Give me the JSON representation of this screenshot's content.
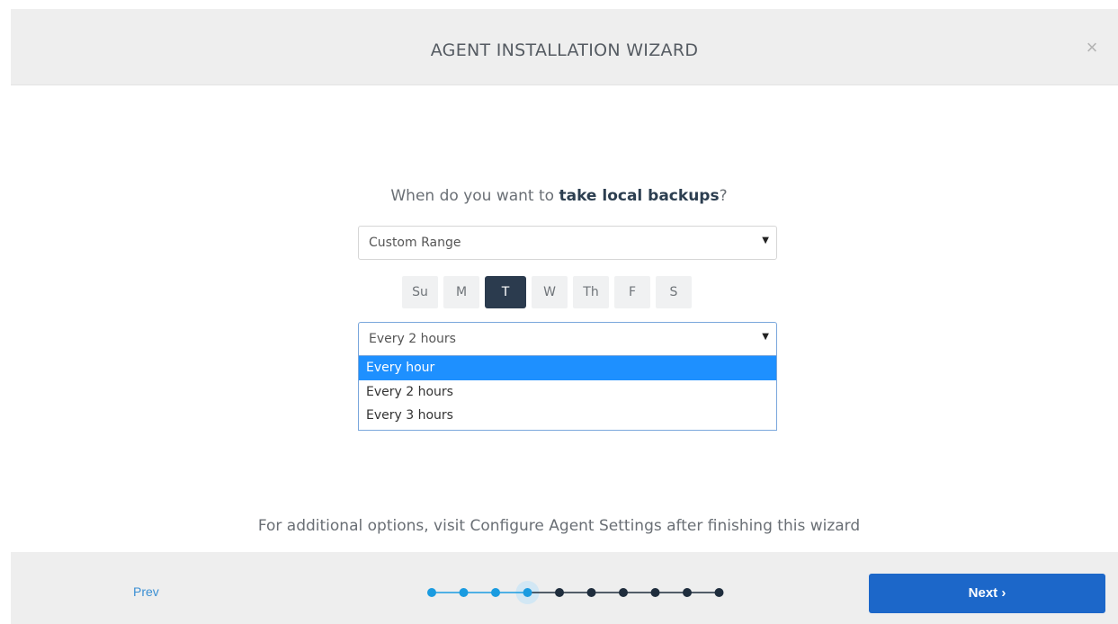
{
  "header": {
    "title": "AGENT INSTALLATION WIZARD",
    "close_label": "×"
  },
  "question": {
    "prefix": "When do you want to ",
    "emphasis": "take local backups",
    "suffix": "?"
  },
  "range_select": {
    "value": "Custom Range"
  },
  "days": [
    {
      "label": "Su",
      "selected": false
    },
    {
      "label": "M",
      "selected": false
    },
    {
      "label": "T",
      "selected": true
    },
    {
      "label": "W",
      "selected": false
    },
    {
      "label": "Th",
      "selected": false
    },
    {
      "label": "F",
      "selected": false
    },
    {
      "label": "S",
      "selected": false
    }
  ],
  "frequency_select": {
    "value": "Every 2 hours",
    "options": [
      {
        "label": "Every hour",
        "highlighted": true
      },
      {
        "label": "Every 2 hours",
        "highlighted": false
      },
      {
        "label": "Every 3 hours",
        "highlighted": false
      }
    ]
  },
  "note": "For additional options, visit Configure Agent Settings after finishing this wizard",
  "footer": {
    "prev_label": "Prev",
    "next_label": "Next ›",
    "steps_total": 10,
    "steps_completed": 3,
    "current_step": 4
  },
  "colors": {
    "step_done": "#1a9be0",
    "step_current": "#1a9be0",
    "step_pending": "#1f2d3d",
    "accent": "#1c67c9"
  }
}
